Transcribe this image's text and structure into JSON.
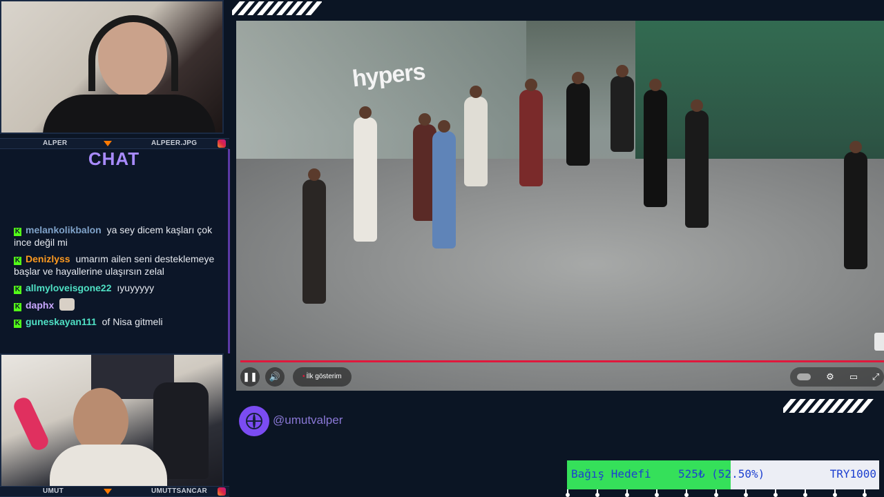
{
  "top_cam": {
    "label_left": "ALPER",
    "label_right": "ALPEER.JPG"
  },
  "bottom_cam": {
    "label_left": "UMUT",
    "label_right": "UMUTTSANCAR"
  },
  "chat": {
    "title": "CHAT",
    "messages": [
      {
        "user": "melankolikbalon",
        "user_color": "#7fa2c9",
        "text": "ya sey dicem kaşları çok ince değil mi"
      },
      {
        "user": "Denizlyss",
        "user_color": "#ff9a1f",
        "text": "umarım ailen seni desteklemeye başlar ve hayallerine ulaşırsın zelal"
      },
      {
        "user": "allmyloveisgone22",
        "user_color": "#4fe0c4",
        "text": "ıyuyyyyy"
      },
      {
        "user": "daphx",
        "user_color": "#c9a8ff",
        "text": ""
      },
      {
        "user": "guneskayan111",
        "user_color": "#4fe0c4",
        "text": "of Nisa gitmeli"
      }
    ]
  },
  "video": {
    "logo_text": "hypers",
    "chapter_label": "İlk gösterim",
    "progress_fraction": 1.0,
    "icons": [
      "pause-icon",
      "volume-icon",
      "settings-icon",
      "subtitles-icon",
      "fullscreen-icon"
    ]
  },
  "social": {
    "handle": "@umutvalper"
  },
  "donation_goal": {
    "label": "Bağış Hedefi",
    "amount": "525₺ (52.50%)",
    "target": "TRY1000",
    "fraction": 0.525
  },
  "colors": {
    "accent": "#7b4cf2",
    "goal_fill": "#35e05a",
    "progress": "#e0183c",
    "kick_green": "#53fc18"
  }
}
